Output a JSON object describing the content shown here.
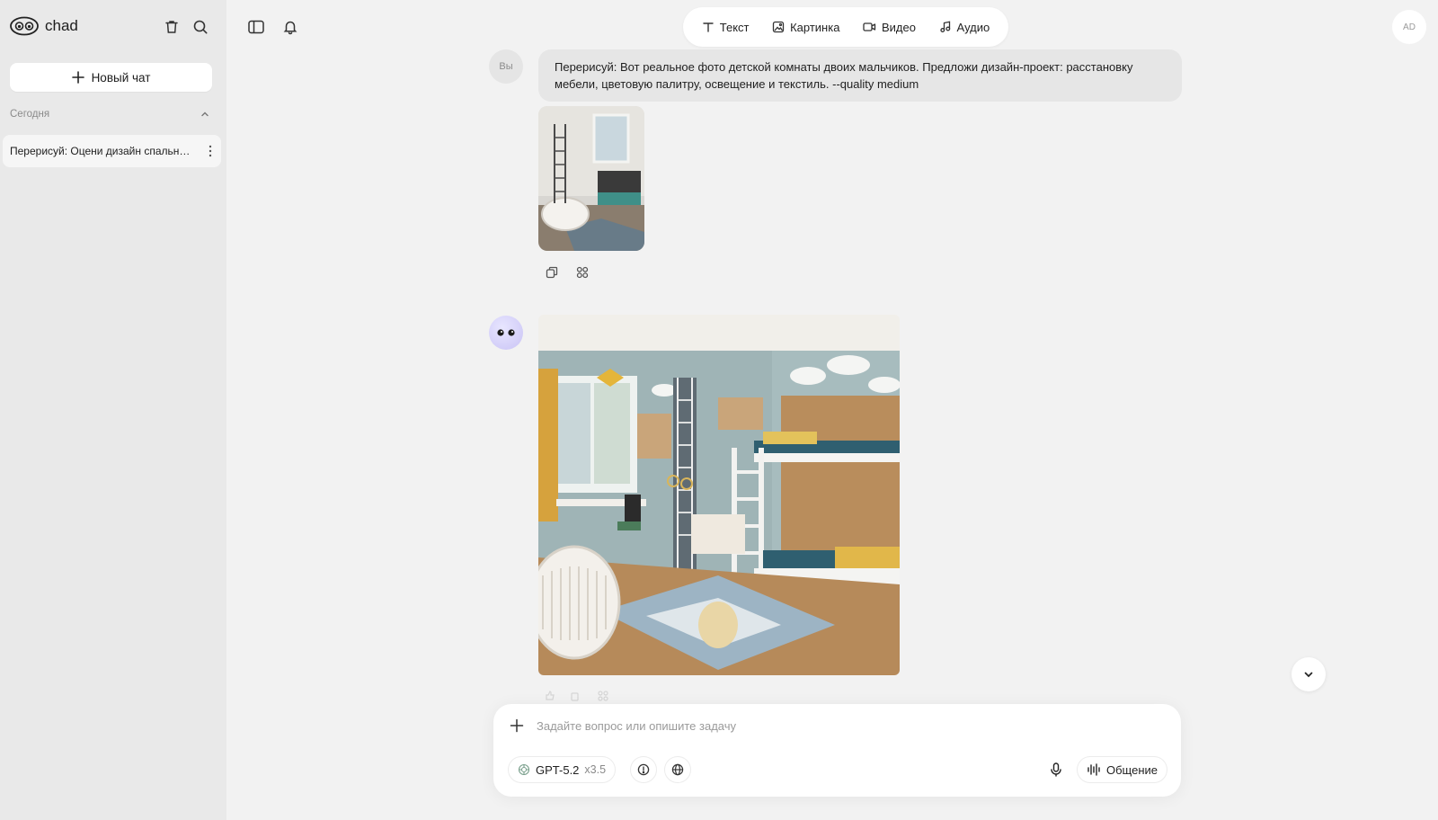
{
  "app": {
    "name": "chad",
    "user_initials": "AD"
  },
  "sidebar": {
    "new_chat_label": "Новый чат",
    "section_today": "Сегодня",
    "chats": [
      {
        "title": "Перерисуй: Оцени дизайн спальни..."
      }
    ]
  },
  "modes": [
    {
      "label": "Текст",
      "icon": "text-icon"
    },
    {
      "label": "Картинка",
      "icon": "image-icon"
    },
    {
      "label": "Видео",
      "icon": "video-icon"
    },
    {
      "label": "Аудио",
      "icon": "music-note-icon"
    }
  ],
  "messages": {
    "user_avatar_label": "Вы",
    "user_text": "Перерисуй: Вот реальное фото детской комнаты двоих мальчиков. Предложи дизайн-проект: расстановку мебели, цветовую палитру, освещение и текстиль. --quality medium"
  },
  "composer": {
    "placeholder": "Задайте вопрос или опишите задачу",
    "model_name": "GPT-5.2",
    "model_multiplier": "x3.5",
    "talk_label": "Общение"
  },
  "colors": {
    "sidebar_bg": "#e9e9e9",
    "main_bg": "#f2f2f2",
    "bubble_bg": "#e6e6e6",
    "bot_avatar": "#c9c3f5"
  }
}
